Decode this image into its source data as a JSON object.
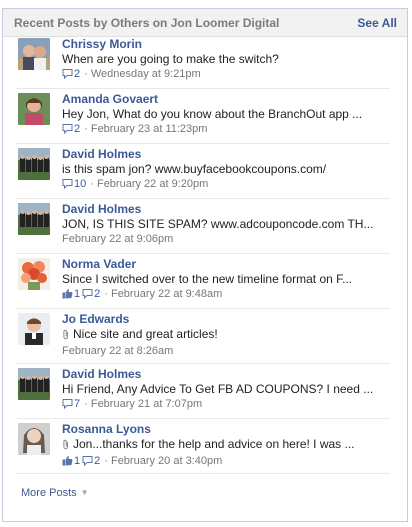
{
  "header": {
    "title": "Recent Posts by Others on Jon Loomer Digital",
    "see_all": "See All"
  },
  "posts": [
    {
      "author": "Chrissy Morin",
      "text": "When are you going to make the switch?",
      "line2": "",
      "likes": "",
      "comments": "2",
      "time": "· Wednesday at 9:21pm",
      "avatar": "photo-couple-icon"
    },
    {
      "author": "Amanda Govaert",
      "text": "Hey Jon, What do you know about the BranchOut app ...",
      "line2": "",
      "likes": "",
      "comments": "2",
      "time": "· February 23 at 11:23pm",
      "avatar": "photo-woman-icon"
    },
    {
      "author": "David Holmes",
      "text": "is this spam jon? www.buyfacebookcoupons.com/",
      "line2": "",
      "likes": "",
      "comments": "10",
      "time": "· February 22 at 9:20pm",
      "avatar": "photo-team-icon"
    },
    {
      "author": "David Holmes",
      "text": "JON, IS THIS SITE SPAM? www.adcouponcode.com TH...",
      "line2": "February 22 at 9:06pm",
      "likes": "",
      "comments": "",
      "time": "",
      "avatar": "photo-team-icon"
    },
    {
      "author": "Norma Vader",
      "text": "Since I switched over to the new timeline format on F...",
      "line2": "",
      "likes": "1",
      "comments": "2",
      "time": "· February 22 at 9:48am",
      "avatar": "photo-flowers-icon"
    },
    {
      "author": "Jo Edwards",
      "text": "Nice site and great articles!",
      "line2": "February 22 at 8:26am",
      "likes": "",
      "comments": "",
      "time": "",
      "avatar": "photo-man-icon",
      "attach": true
    },
    {
      "author": "David Holmes",
      "text": "Hi Friend, Any Advice To Get FB AD COUPONS? I need ...",
      "line2": "",
      "likes": "",
      "comments": "7",
      "time": "· February 21 at 7:07pm",
      "avatar": "photo-team-icon"
    },
    {
      "author": "Rosanna Lyons",
      "text": "Jon...thanks for the help and advice on here! I was ...",
      "line2": "",
      "likes": "1",
      "comments": "2",
      "time": "· February 20 at 3:40pm",
      "avatar": "photo-woman2-icon",
      "attach": true
    }
  ],
  "footer": {
    "more_posts": "More Posts"
  },
  "colors": {
    "link": "#3b5998",
    "border": "#c4cde0",
    "meta": "#777777"
  }
}
